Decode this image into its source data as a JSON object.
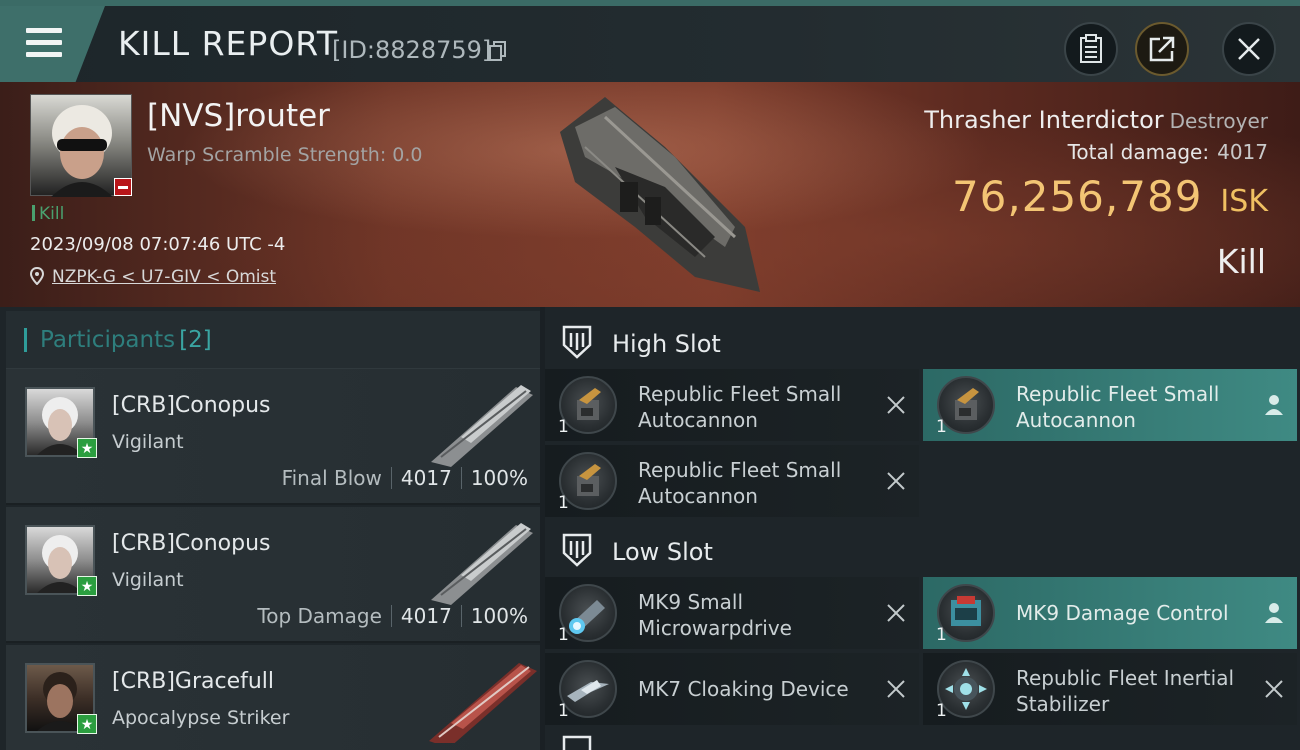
{
  "header": {
    "title": "KILL REPORT",
    "id_label": "[ID:8828759]"
  },
  "victim": {
    "name": "[NVS]router",
    "warp_scramble": "Warp Scramble Strength: 0.0",
    "kill_tag": "Kill",
    "timestamp": "2023/09/08 07:07:46 UTC -4",
    "location": "NZPK-G < U7-GIV < Omist",
    "ship_name": "Thrasher Interdictor",
    "ship_class": "Destroyer",
    "total_damage_label": "Total damage:",
    "total_damage": "4017",
    "isk_value": "76,256,789",
    "isk_currency": "ISK",
    "result": "Kill"
  },
  "participants": {
    "title": "Participants",
    "count": "[2]",
    "items": [
      {
        "name": "[CRB]Conopus",
        "ship": "Vigilant",
        "role": "Final Blow",
        "damage": "4017",
        "percent": "100%"
      },
      {
        "name": "[CRB]Conopus",
        "ship": "Vigilant",
        "role": "Top Damage",
        "damage": "4017",
        "percent": "100%"
      },
      {
        "name": "[CRB]Gracefull",
        "ship": "Apocalypse Striker"
      }
    ]
  },
  "fitting": {
    "high_slot": {
      "label": "High Slot",
      "modules": [
        {
          "name": "Republic Fleet Small Autocannon",
          "qty": "1",
          "state": "destroyed"
        },
        {
          "name": "Republic Fleet Small Autocannon",
          "qty": "1",
          "state": "dropped"
        },
        {
          "name": "Republic Fleet Small Autocannon",
          "qty": "1",
          "state": "destroyed"
        }
      ]
    },
    "low_slot": {
      "label": "Low Slot",
      "modules": [
        {
          "name": "MK9 Small Microwarpdrive",
          "qty": "1",
          "state": "destroyed"
        },
        {
          "name": "MK9 Damage Control",
          "qty": "1",
          "state": "dropped"
        },
        {
          "name": "MK7 Cloaking Device",
          "qty": "1",
          "state": "destroyed"
        },
        {
          "name": "Republic Fleet Inertial Stabilizer",
          "qty": "1",
          "state": "destroyed"
        }
      ]
    }
  },
  "colors": {
    "accent_teal": "#3e6f6a",
    "isk_gold": "#f3c574",
    "kill_green": "#4aa06e",
    "active_module": "#3f8a83"
  },
  "icons": [
    "menu-icon",
    "copy-icon",
    "clipboard-icon",
    "share-icon",
    "close-icon",
    "location-pin-icon",
    "slot-icon",
    "remove-x-icon",
    "person-icon",
    "star-icon"
  ]
}
